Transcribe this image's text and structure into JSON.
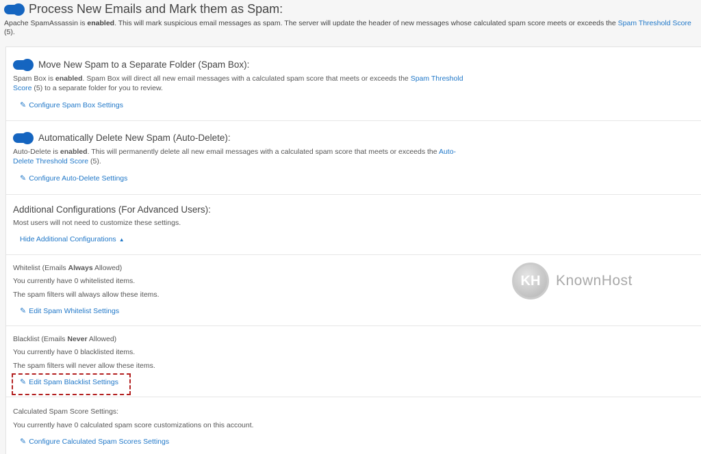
{
  "main": {
    "title": "Process New Emails and Mark them as Spam:",
    "desc_pre": "Apache SpamAssassin is ",
    "desc_bold": "enabled",
    "desc_mid": ". This will mark suspicious email messages as spam. The server will update the header of new messages whose calculated spam score meets or exceeds the ",
    "desc_link": "Spam Threshold Score",
    "desc_post": " (5)."
  },
  "spam_box": {
    "title": "Move New Spam to a Separate Folder (Spam Box):",
    "desc_pre": "Spam Box is ",
    "desc_bold": "enabled",
    "desc_mid": ". Spam Box will direct all new email messages with a calculated spam score that meets or exceeds the ",
    "desc_link": "Spam Threshold Score",
    "desc_post": " (5) to a separate folder for you to review.",
    "link": "Configure Spam Box Settings"
  },
  "auto_delete": {
    "title": "Automatically Delete New Spam (Auto-Delete):",
    "desc_pre": "Auto-Delete is ",
    "desc_bold": "enabled",
    "desc_mid": ". This will permanently delete all new email messages with a calculated spam score that meets or exceeds the ",
    "desc_link": "Auto-Delete Threshold Score",
    "desc_post": " (5).",
    "link": "Configure Auto-Delete Settings"
  },
  "additional": {
    "title": "Additional Configurations (For Advanced Users):",
    "desc": "Most users will not need to customize these settings.",
    "link": "Hide Additional Configurations"
  },
  "whitelist": {
    "title_pre": "Whitelist (Emails ",
    "title_bold": "Always",
    "title_post": " Allowed)",
    "line1": "You currently have 0 whitelisted items.",
    "line2": "The spam filters will always allow these items.",
    "link": "Edit Spam Whitelist Settings"
  },
  "blacklist": {
    "title_pre": "Blacklist (Emails ",
    "title_bold": "Never",
    "title_post": " Allowed)",
    "line1": "You currently have 0 blacklisted items.",
    "line2": "The spam filters will never allow these items.",
    "link": "Edit Spam Blacklist Settings"
  },
  "score": {
    "title": "Calculated Spam Score Settings:",
    "line1": "You currently have 0 calculated spam score customizations on this account.",
    "link": "Configure Calculated Spam Scores Settings"
  },
  "watermark": {
    "logo": "KH",
    "text": "KnownHost"
  },
  "colors": {
    "accent": "#1f77c8",
    "toggle": "#1565c0",
    "highlight": "#b32020"
  }
}
